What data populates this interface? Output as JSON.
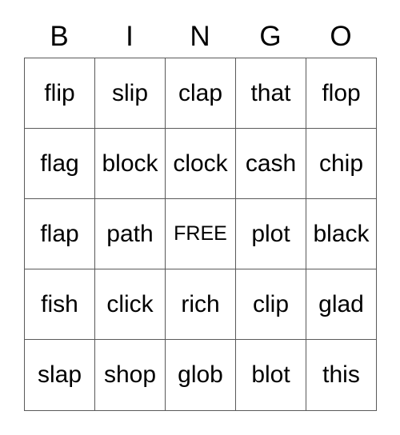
{
  "card": {
    "title_letters": [
      "B",
      "I",
      "N",
      "G",
      "O"
    ],
    "free_space_label": "FREE",
    "rows": [
      [
        "flip",
        "slip",
        "clap",
        "that",
        "flop"
      ],
      [
        "flag",
        "block",
        "clock",
        "cash",
        "chip"
      ],
      [
        "flap",
        "path",
        "FREE",
        "plot",
        "black"
      ],
      [
        "fish",
        "click",
        "rich",
        "clip",
        "glad"
      ],
      [
        "slap",
        "shop",
        "glob",
        "blot",
        "this"
      ]
    ],
    "colors": {
      "background": "#ffffff",
      "text": "#000000",
      "grid_line": "#5a5a5a"
    }
  }
}
